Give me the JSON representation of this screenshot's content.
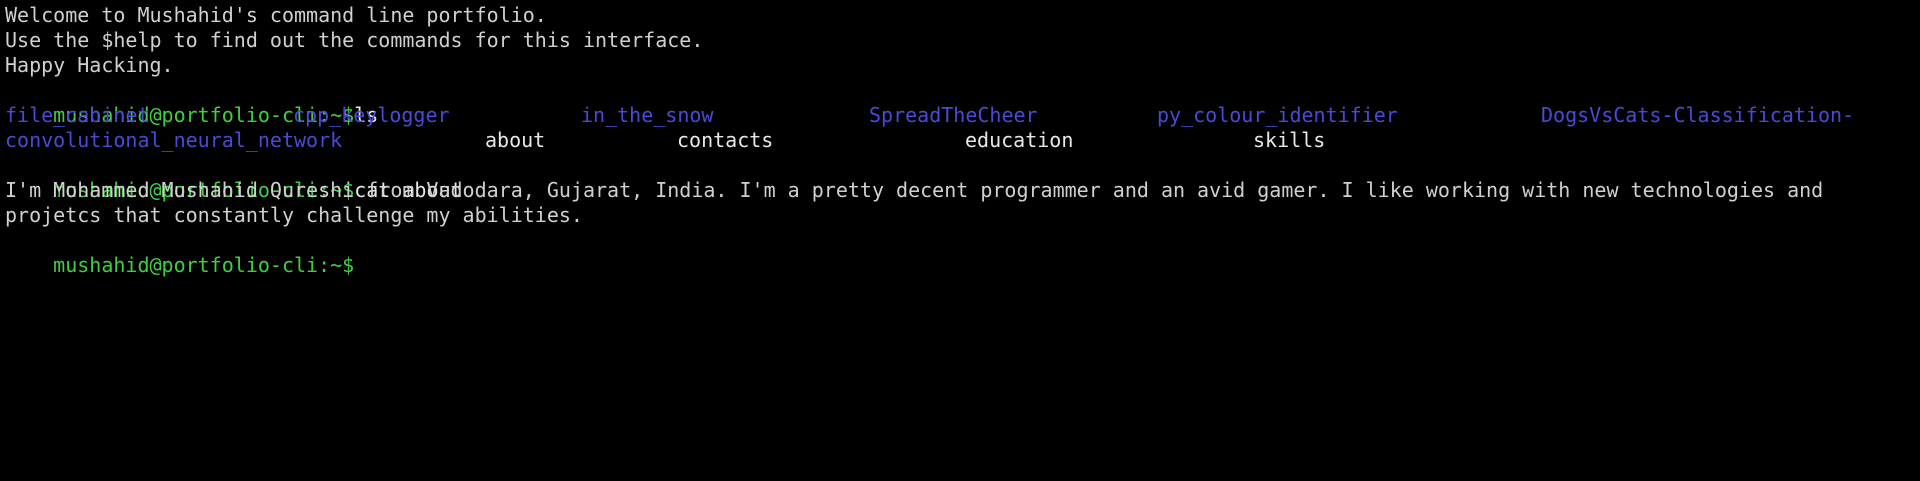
{
  "colors": {
    "background": "#000000",
    "text": "#d0d0d0",
    "prompt": "#3fcf3f",
    "directory": "#4a4ad6",
    "file": "#e8e8e8"
  },
  "welcome": [
    "Welcome to Mushahid's command line portfolio.",
    "Use the $help to find out the commands for this interface.",
    "Happy Hacking."
  ],
  "prompt": "mushahid@portfolio-cli:~$",
  "session": {
    "cmd1": "ls",
    "ls_output": {
      "dirs": [
        "file_cabinet",
        "cpp_keylogger",
        "in_the_snow",
        "SpreadTheCheer",
        "py_colour_identifier",
        "DogsVsCats-Classification-",
        "convolutional_neural_network"
      ],
      "files": [
        "about",
        "contacts",
        "education",
        "skills"
      ]
    },
    "cmd2": "cat about",
    "about_output": "I'm Mohammed Mushahid Qureshi from Vadodara, Gujarat, India. I'm a pretty decent programmer and an avid gamer. I like working with new technologies and projetcs that constantly challenge my abilities.",
    "cmd3": ""
  }
}
